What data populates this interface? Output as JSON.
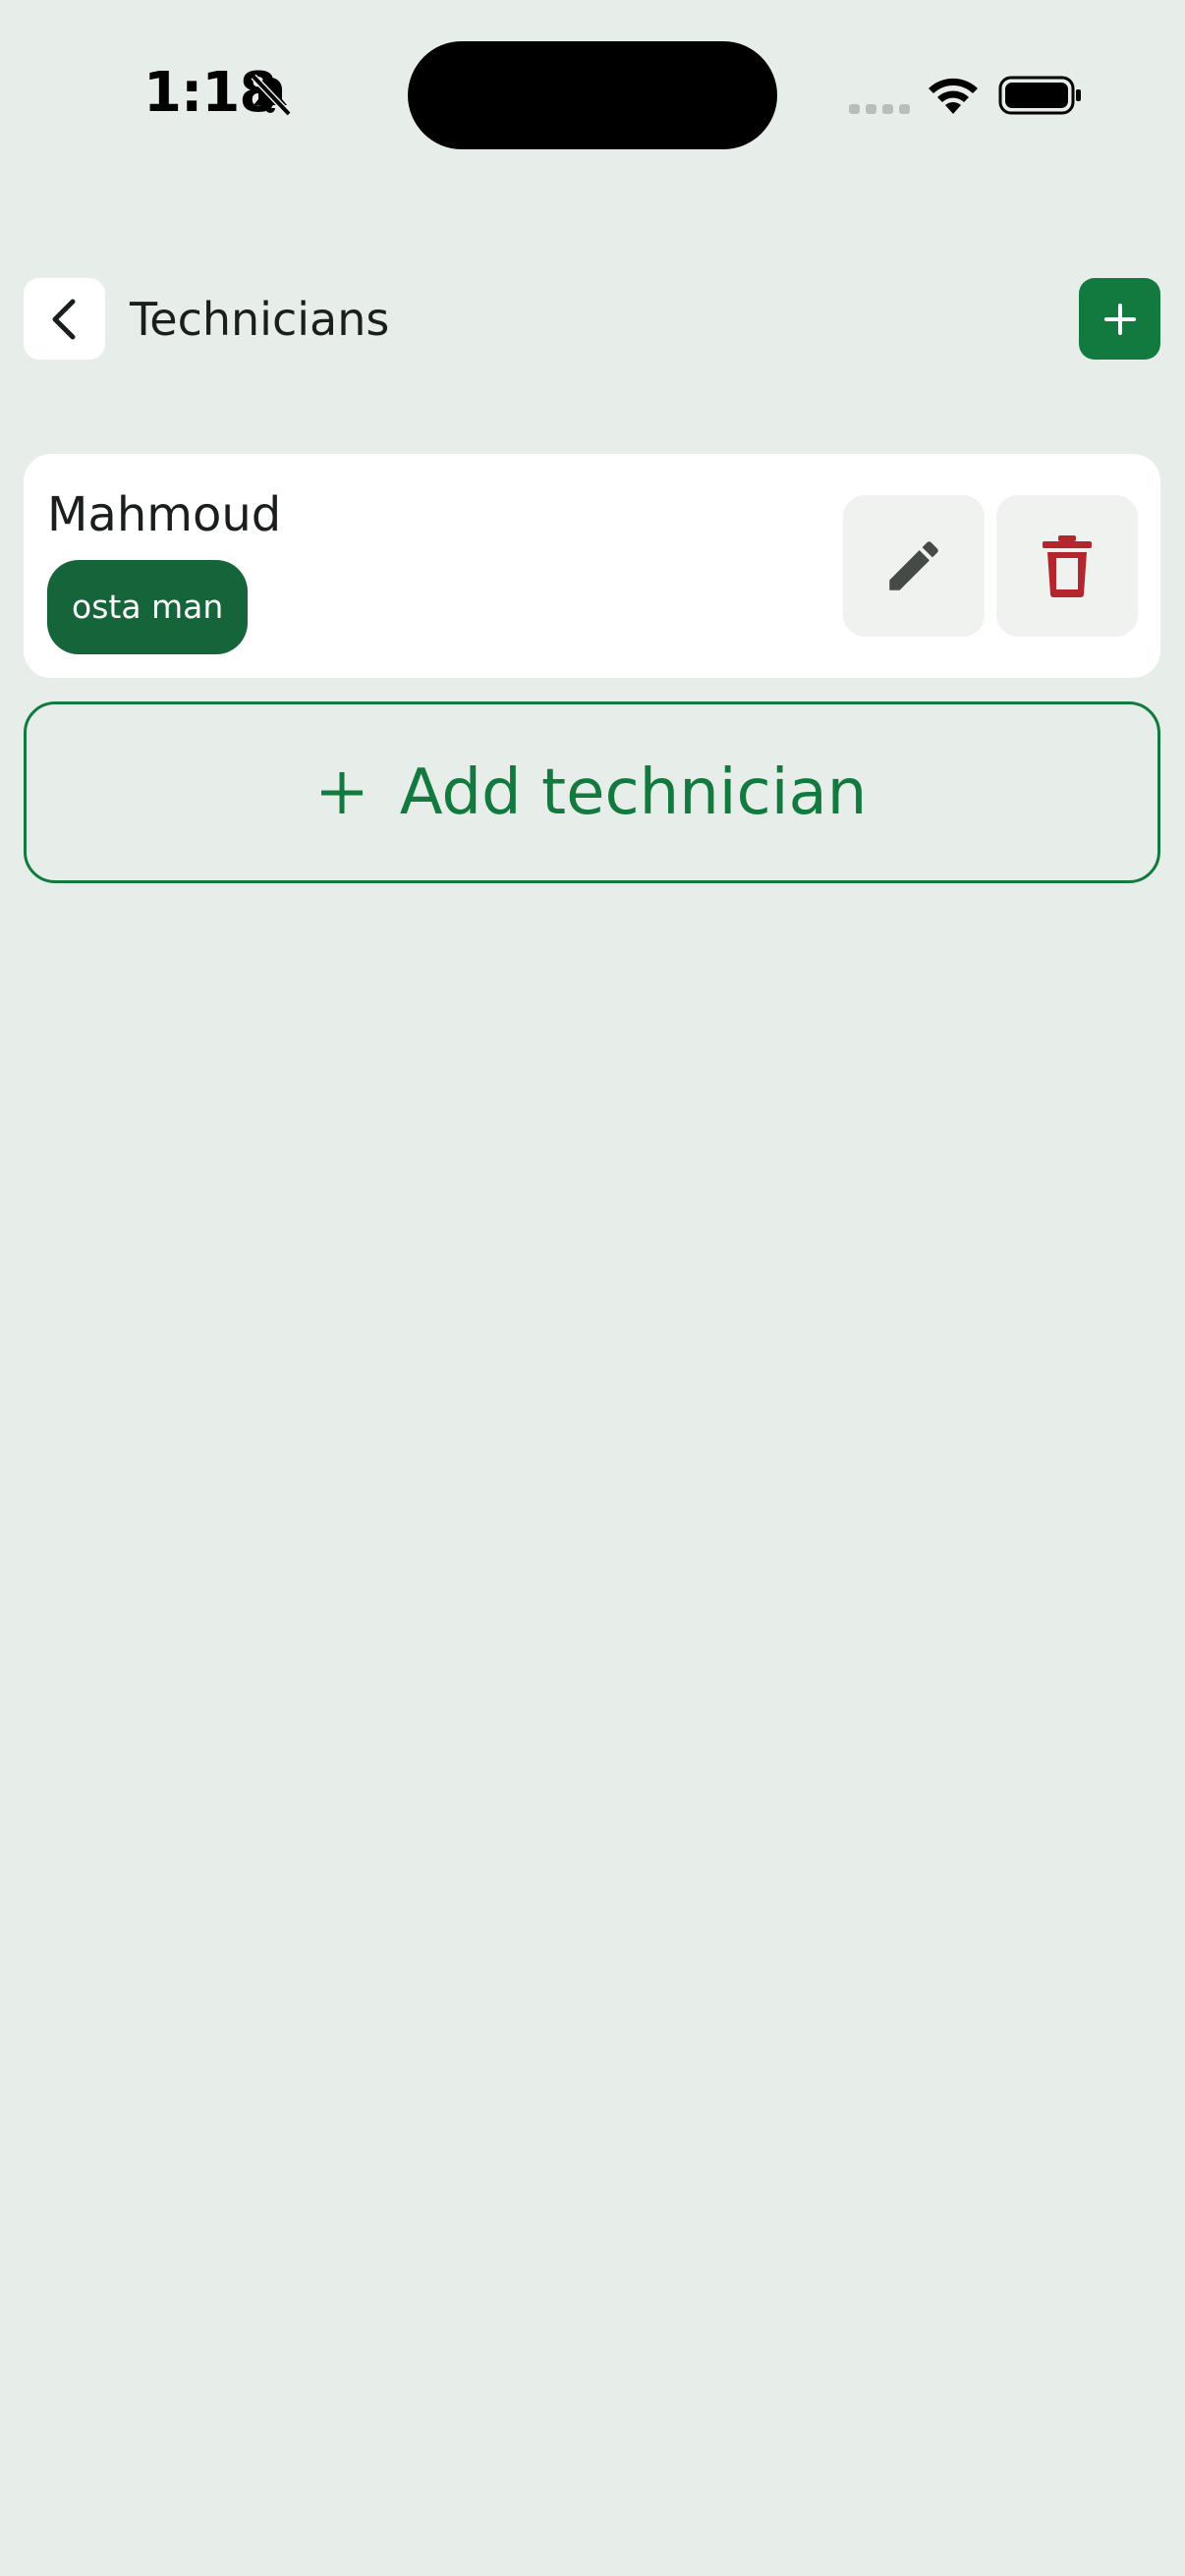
{
  "status_bar": {
    "time": "1:18",
    "icons": [
      "bell-slash-icon",
      "cellular-signal-icon",
      "wifi-icon",
      "battery-icon"
    ]
  },
  "header": {
    "title": "Technicians",
    "back_icon": "chevron-left-icon",
    "add_icon": "plus-icon"
  },
  "technicians": [
    {
      "name": "Mahmoud",
      "role": "osta man",
      "edit_icon": "pencil-icon",
      "delete_icon": "trash-icon"
    }
  ],
  "add_technician": {
    "label": "Add technician",
    "icon": "plus-icon"
  },
  "colors": {
    "background": "#e7eeea",
    "primary": "#137a3f",
    "badge": "#16643a",
    "danger": "#b3262d",
    "card": "#ffffff"
  }
}
